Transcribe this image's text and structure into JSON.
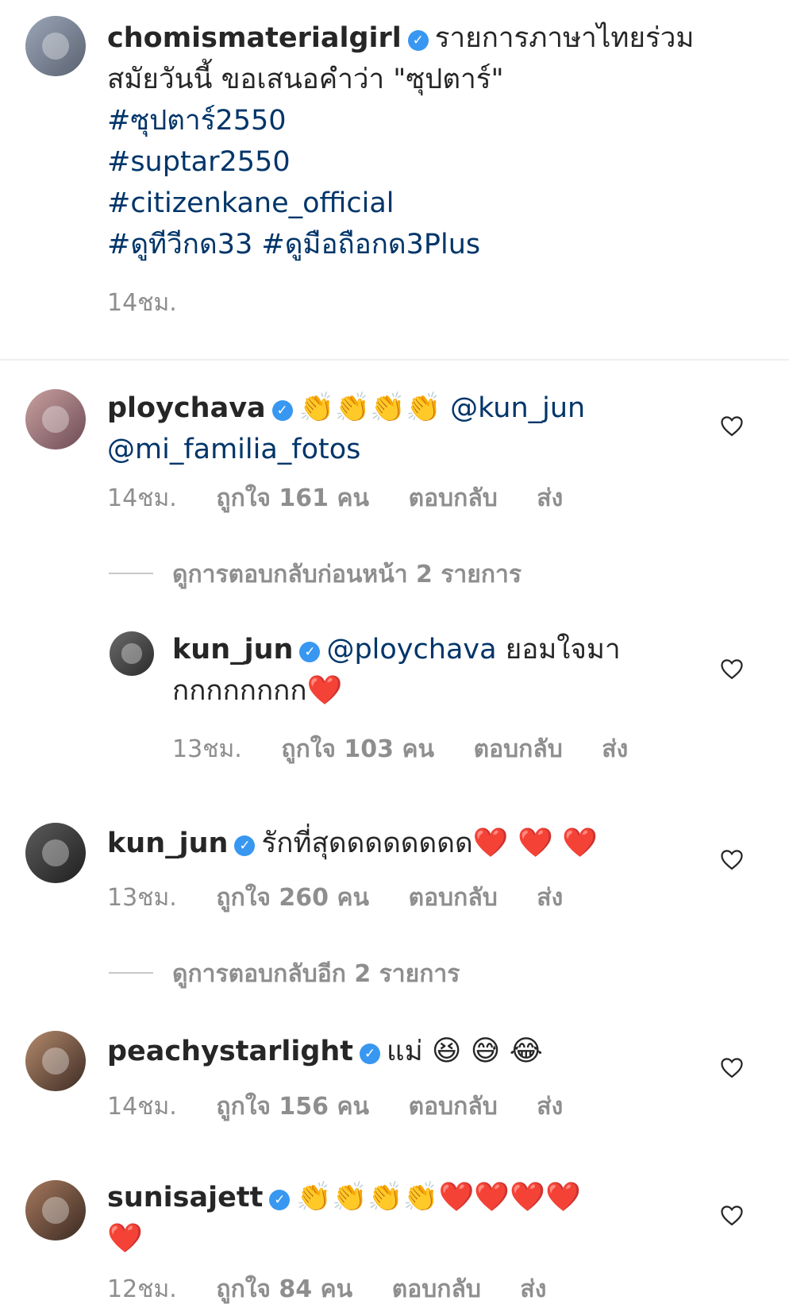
{
  "caption": {
    "username": "chomismaterialgirl",
    "text_line1": "รายการภาษาไทยร่วม",
    "text_line2": "สมัยวันนี้ ขอเสนอคำว่า \"ซุปตาร์\"",
    "hashtags": [
      "#ซุปตาร์2550",
      "#suptar2550",
      "#citizenkane_official",
      "#ดูทีวีกด33 #ดูมือถือกด3Plus"
    ],
    "time": "14ชม."
  },
  "comments": [
    {
      "username": "ploychava",
      "emojis": "👏👏👏👏",
      "mention1": "@kun_jun",
      "mention2": "@mi_familia_fotos",
      "time": "14ชม.",
      "likes": "ถูกใจ 161 คน",
      "reply": "ตอบกลับ",
      "send": "ส่ง"
    },
    {
      "username": "kun_jun",
      "mention": "@ploychava",
      "text_a": "ยอมใจมา",
      "text_b": "กกกกกกกก",
      "emojis": "❤️",
      "time": "13ชม.",
      "likes": "ถูกใจ 103 คน",
      "reply": "ตอบกลับ",
      "send": "ส่ง"
    },
    {
      "username": "kun_jun",
      "text": "รักที่สุดดดดดดดด",
      "emojis": "❤️ ❤️ ❤️",
      "time": "13ชม.",
      "likes": "ถูกใจ 260 คน",
      "reply": "ตอบกลับ",
      "send": "ส่ง"
    },
    {
      "username": "peachystarlight",
      "text": "แม่",
      "emojis": "😆 😅 😂",
      "time": "14ชม.",
      "likes": "ถูกใจ 156 คน",
      "reply": "ตอบกลับ",
      "send": "ส่ง"
    },
    {
      "username": "sunisajett",
      "emojis": "👏👏👏👏❤️❤️❤️❤️",
      "emojis_line2": "❤️",
      "time": "12ชม.",
      "likes": "ถูกใจ 84 คน",
      "reply": "ตอบกลับ",
      "send": "ส่ง"
    }
  ],
  "view_previous_replies": "ดูการตอบกลับก่อนหน้า 2 รายการ",
  "view_more_replies": "ดูการตอบกลับอีก 2 รายการ",
  "colors": {
    "text": "#262626",
    "link": "#003569",
    "meta": "#8e8e8e",
    "verified": "#3897f0",
    "divider": "#efefef"
  },
  "icons": {
    "verified": "verified-badge-icon",
    "like": "heart-outline-icon"
  }
}
